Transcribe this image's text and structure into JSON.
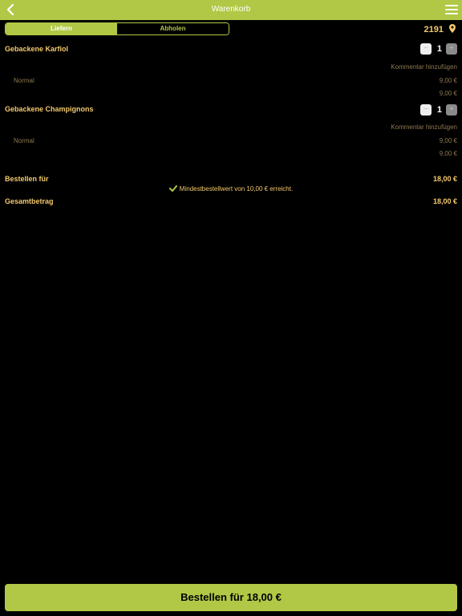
{
  "header": {
    "title": "Warenkorb"
  },
  "delivery_mode": {
    "options": [
      "Liefern",
      "Abholen"
    ],
    "selected": "Liefern"
  },
  "postcode": "2191",
  "items": [
    {
      "name": "Gebackene Karfiol",
      "quantity": "1",
      "comment_label": "Kommentar hinzufügen",
      "variant": "Normal",
      "variant_price": "9,00 €",
      "line_total": "9,00 €"
    },
    {
      "name": "Gebackene Champignons",
      "quantity": "1",
      "comment_label": "Kommentar hinzufügen",
      "variant": "Normal",
      "variant_price": "9,00 €",
      "line_total": "9,00 €"
    }
  ],
  "summary": {
    "order_for_label": "Bestellen für",
    "order_for_value": "18,00 €",
    "min_order_notice": "Mindestbestellwert von 10,00 € erreicht.",
    "total_label": "Gesamtbetrag",
    "total_value": "18,00 €"
  },
  "order_button": {
    "label": "Bestellen für 18,00 €"
  },
  "colors": {
    "accent": "#b0c845",
    "text_gold": "#f3c96b",
    "text_muted": "#8e7a4e",
    "background": "#000000"
  },
  "icons": [
    "back-chevron-icon",
    "menu-icon",
    "location-pin-icon",
    "minus-icon",
    "plus-icon",
    "check-icon"
  ]
}
